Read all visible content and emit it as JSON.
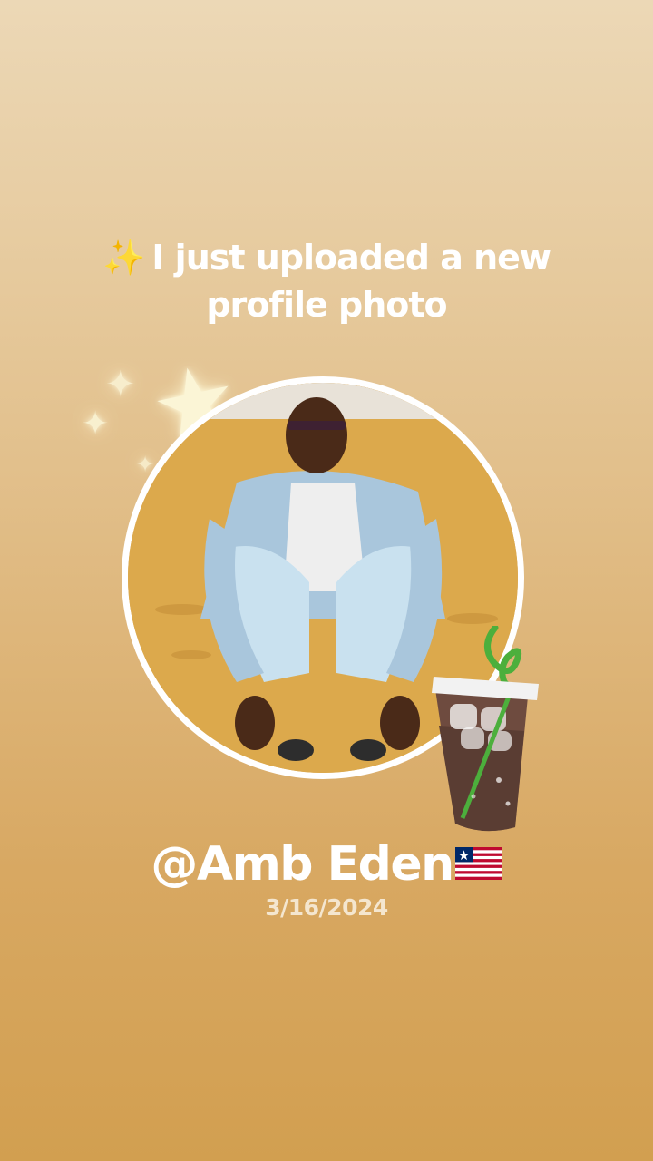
{
  "headline": {
    "icon": "sparkles-icon",
    "line1": "I just uploaded a new",
    "line2": "profile photo"
  },
  "profile": {
    "username": "@Amb Eden",
    "flag": "liberia-flag-icon",
    "date": "3/16/2024"
  },
  "decorations": {
    "stars": "star-icon",
    "sticker": "iced-coffee-icon"
  },
  "colors": {
    "background_top": "#ecd8b6",
    "background_bottom": "#d29f50",
    "text": "#ffffff",
    "date_text": "#f4e6cf"
  }
}
